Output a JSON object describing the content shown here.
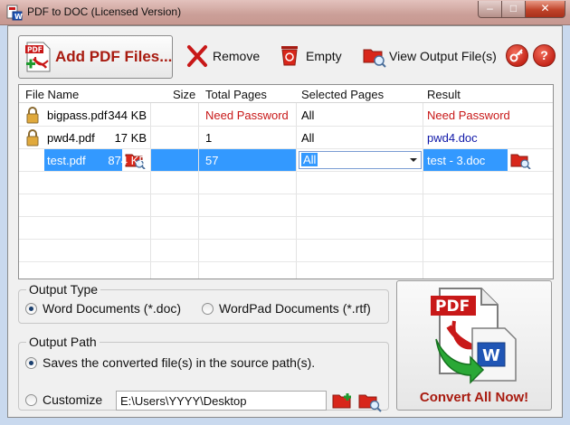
{
  "window": {
    "title": "PDF to DOC (Licensed Version)"
  },
  "toolbar": {
    "add_label": "Add PDF Files...",
    "remove_label": "Remove",
    "empty_label": "Empty",
    "view_label": "View Output File(s)"
  },
  "grid": {
    "columns": [
      "File Name",
      "Size",
      "Total Pages",
      "Selected Pages",
      "Result"
    ],
    "rows": [
      {
        "name": "bigpass.pdf",
        "size": "344 KB",
        "pages": "Need Password",
        "selected": "All",
        "result": "Need Password"
      },
      {
        "name": "pwd4.pdf",
        "size": "17 KB",
        "pages": "1",
        "selected": "All",
        "result": "pwd4.doc"
      },
      {
        "name": "test.pdf",
        "size": "874 KB",
        "pages": "57",
        "selected": "All",
        "result": "test - 3.doc"
      }
    ]
  },
  "output_type": {
    "legend": "Output Type",
    "opt_word": "Word Documents (*.doc)",
    "opt_wordpad": "WordPad Documents (*.rtf)",
    "selected": "word"
  },
  "output_path": {
    "legend": "Output Path",
    "opt_source": "Saves the converted file(s) in the source path(s).",
    "opt_custom": "Customize",
    "path_value": "E:\\Users\\YYYY\\Desktop",
    "selected": "source"
  },
  "convert": {
    "label": "Convert All Now!"
  },
  "colors": {
    "accent_red": "#a81b10",
    "selection": "#3399ff",
    "link_blue": "#1018a8"
  }
}
